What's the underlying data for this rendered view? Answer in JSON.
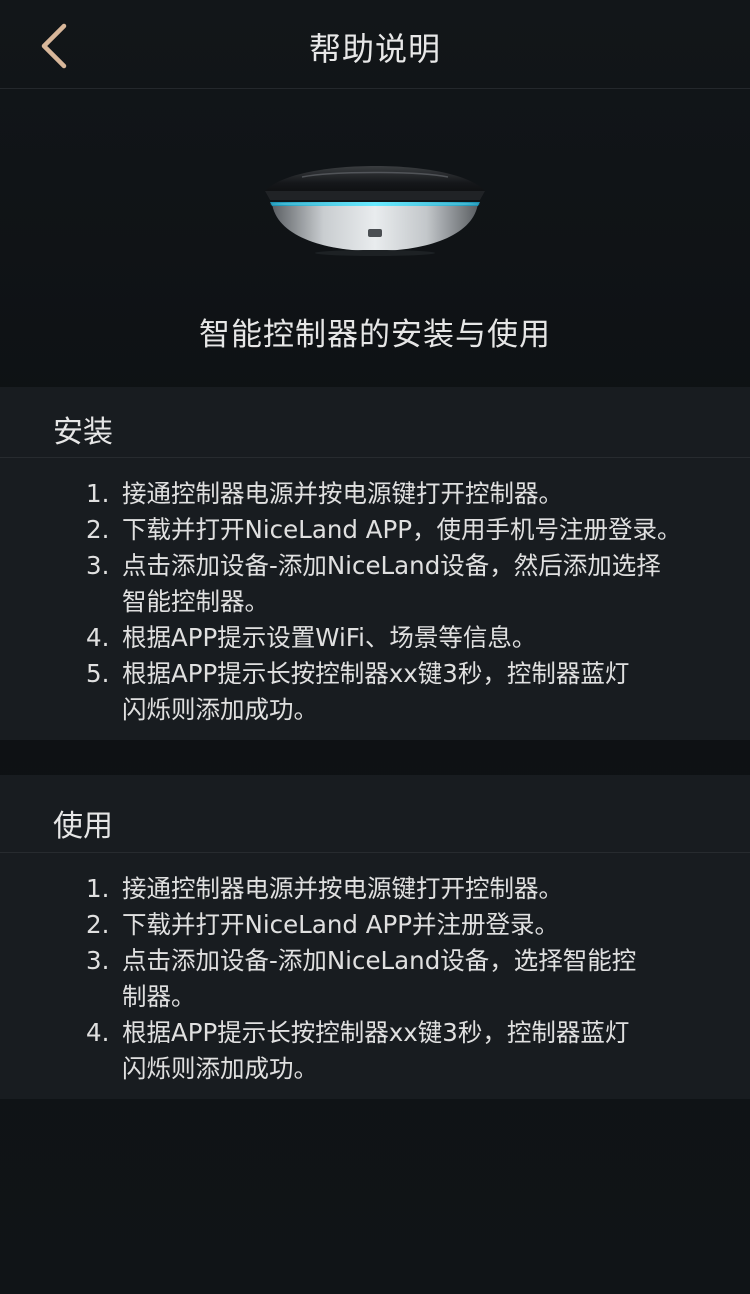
{
  "navbar": {
    "title": "帮助说明",
    "back_icon": "chevron-left-icon",
    "back_color": "#d8b79a"
  },
  "hero": {
    "image": "smart-controller-device",
    "title": "智能控制器的安装与使用",
    "accent_color": "#3fd0e8"
  },
  "install": {
    "title": "安装",
    "steps": [
      {
        "num": "1.",
        "line1": "接通控制器电源并按电源键打开控制器。",
        "line2": ""
      },
      {
        "num": "2.",
        "line1": "下载并打开NiceLand APP，使用手机号注册登录。",
        "line2": ""
      },
      {
        "num": "3.",
        "line1": "点击添加设备-添加NiceLand设备，然后添加选择",
        "line2": "智能控制器。"
      },
      {
        "num": "4.",
        "line1": "根据APP提示设置WiFi、场景等信息。",
        "line2": ""
      },
      {
        "num": "5.",
        "line1": "根据APP提示长按控制器xx键3秒，控制器蓝灯",
        "line2": "闪烁则添加成功。"
      }
    ]
  },
  "usage": {
    "title": "使用",
    "steps": [
      {
        "num": "1.",
        "line1": "接通控制器电源并按电源键打开控制器。",
        "line2": ""
      },
      {
        "num": "2.",
        "line1": "下载并打开NiceLand APP并注册登录。",
        "line2": ""
      },
      {
        "num": "3.",
        "line1": "点击添加设备-添加NiceLand设备，选择智能控",
        "line2": "制器。"
      },
      {
        "num": "4.",
        "line1": "根据APP提示长按控制器xx键3秒，控制器蓝灯",
        "line2": "闪烁则添加成功。"
      }
    ]
  }
}
